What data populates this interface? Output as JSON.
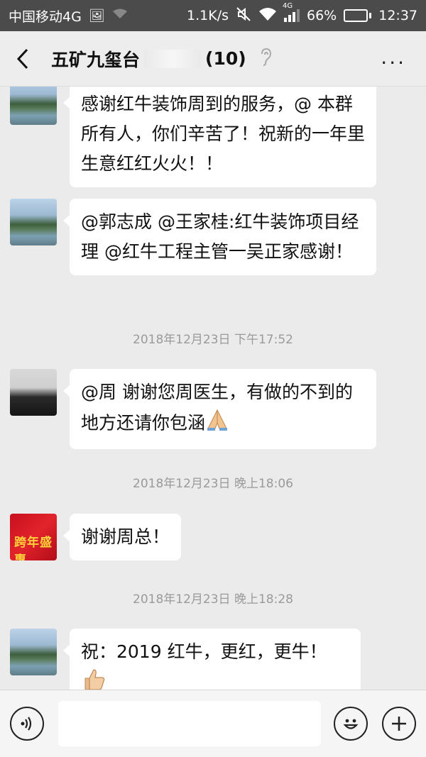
{
  "status_bar": {
    "carrier": "中国移动4G",
    "speed": "1.1K/s",
    "network": "4G",
    "battery_percent": "66%",
    "battery_level": 0.66,
    "time": "12:37"
  },
  "header": {
    "title_prefix": "五矿九玺台",
    "member_count": "(10)",
    "more_label": "···"
  },
  "messages": [
    {
      "type": "text",
      "avatar": "lake-avatar",
      "text": "感谢红牛装饰周到的服务，@ 本群所有人，你们辛苦了！祝新的一年里生意红红火火！！"
    },
    {
      "type": "text",
      "avatar": "lake-avatar",
      "text": "@郭志成 @王家桂:红牛装饰项目经理 @红牛工程主管一吴正家感谢！"
    },
    {
      "type": "time",
      "text": "2018年12月23日 下午17:52"
    },
    {
      "type": "text",
      "avatar": "person-avatar",
      "text": "@周     谢谢您周医生，有做的不到的地方还请你包涵"
    },
    {
      "type": "time",
      "text": "2018年12月23日 晚上18:06"
    },
    {
      "type": "text",
      "avatar": "poster-avatar",
      "text": "谢谢周总！"
    },
    {
      "type": "time",
      "text": "2018年12月23日 晚上18:28"
    },
    {
      "type": "text",
      "avatar": "lake-avatar",
      "text": "祝：2019 红牛，更红，更牛！"
    }
  ],
  "poster_text": "跨年盛惠",
  "input": {
    "placeholder": "",
    "value": ""
  },
  "icons": {
    "voice": "voice-icon",
    "emoji": "emoji-icon",
    "plus": "plus-icon",
    "back": "back-arrow-icon",
    "ear": "ear-icon"
  }
}
